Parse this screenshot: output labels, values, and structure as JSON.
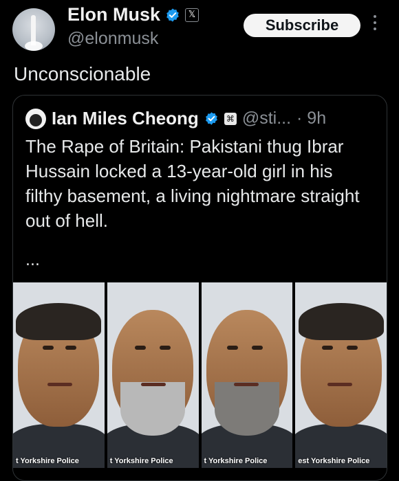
{
  "header": {
    "name": "Elon Musk",
    "handle": "@elonmusk",
    "subscribe_label": "Subscribe",
    "avatar_icon": "starship-launch-avatar",
    "verified_icon": "verified-badge-icon",
    "affiliate_icon": "x-affiliation-icon",
    "more_icon": "more-options-icon"
  },
  "post": {
    "text": "Unconscionable"
  },
  "quote": {
    "name": "Ian Miles Cheong",
    "handle": "@sti...",
    "time": "· 9h",
    "body": "The Rape of Britain: Pakistani thug Ibrar Hussain locked a 13-year-old girl in his filthy basement, a living nightmare straight out of hell.",
    "ellipsis": "...",
    "images": [
      {
        "caption": "t Yorkshire Police"
      },
      {
        "caption": "t Yorkshire Police"
      },
      {
        "caption": "t Yorkshire Police"
      },
      {
        "caption": "est Yorkshire Police"
      }
    ]
  },
  "colors": {
    "background": "#000000",
    "text": "#e7e9ea",
    "muted": "#8b9096",
    "verified": "#1d9bf0"
  }
}
